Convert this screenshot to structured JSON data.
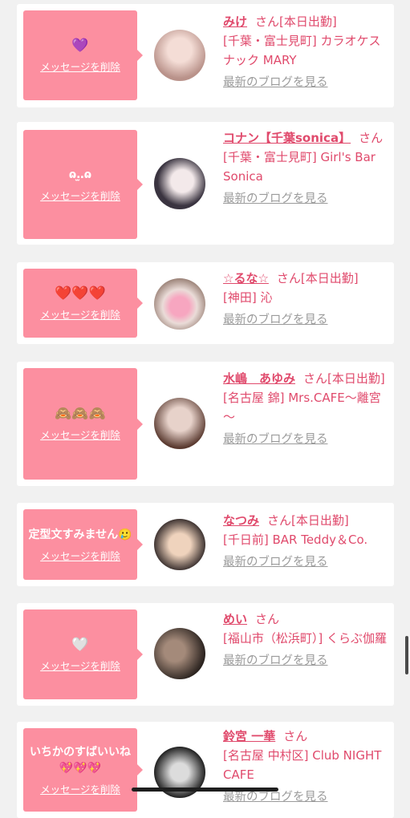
{
  "ui": {
    "delete_label": "メッセージを削除",
    "blog_label": "最新のブログを見る",
    "honorific": "さん"
  },
  "colors": {
    "background": "#f1f1f1",
    "bubble": "#fc8fa0",
    "name": "#e04a6c",
    "link_gray": "#9b9b9b"
  },
  "items": [
    {
      "message": "💜",
      "name": "みけ",
      "status": "[本日出勤]",
      "shop": "[千葉・富士見町] カラオケスナック MARY",
      "avatar_colors": [
        "#f0d6cf",
        "#b9928a"
      ]
    },
    {
      "message": "ɷ․̫․ɷ",
      "name": "コナン【千葉sonica】",
      "status": "",
      "shop": "[千葉・富士見町] Girl's Bar Sonica",
      "avatar_colors": [
        "#e8e4ec",
        "#3a3440"
      ]
    },
    {
      "message": "❤️❤️❤️",
      "name": "☆るな☆",
      "status": "[本日出勤]",
      "shop": "[神田] 沁",
      "avatar_colors": [
        "#f6e8ea",
        "#8a6f63"
      ]
    },
    {
      "message": "🙈🙈🙈",
      "name": "水嶋　あゆみ",
      "status": "[本日出勤]",
      "shop": "[名古屋 錦] Mrs.CAFE～離宮～",
      "avatar_colors": [
        "#d9c8c2",
        "#5a3a30"
      ]
    },
    {
      "message": "定型文すみません🥲",
      "name": "なつみ",
      "status": "[本日出勤]",
      "shop": "[千日前] BAR Teddy＆Co.",
      "avatar_colors": [
        "#e6c4a9",
        "#2d2424"
      ]
    },
    {
      "message": "🤍",
      "name": "めい",
      "status": "",
      "shop": "[福山市（松浜町）] くらぶ伽羅",
      "avatar_colors": [
        "#7c6a5e",
        "#2c2420"
      ]
    },
    {
      "message": "いちかのすばいいね💖💖💖",
      "name": "鈴宮 一華",
      "status": "",
      "shop": "[名古屋 中村区] Club NIGHT CAFE",
      "avatar_colors": [
        "#cfcfcf",
        "#1b1b1b"
      ]
    }
  ]
}
